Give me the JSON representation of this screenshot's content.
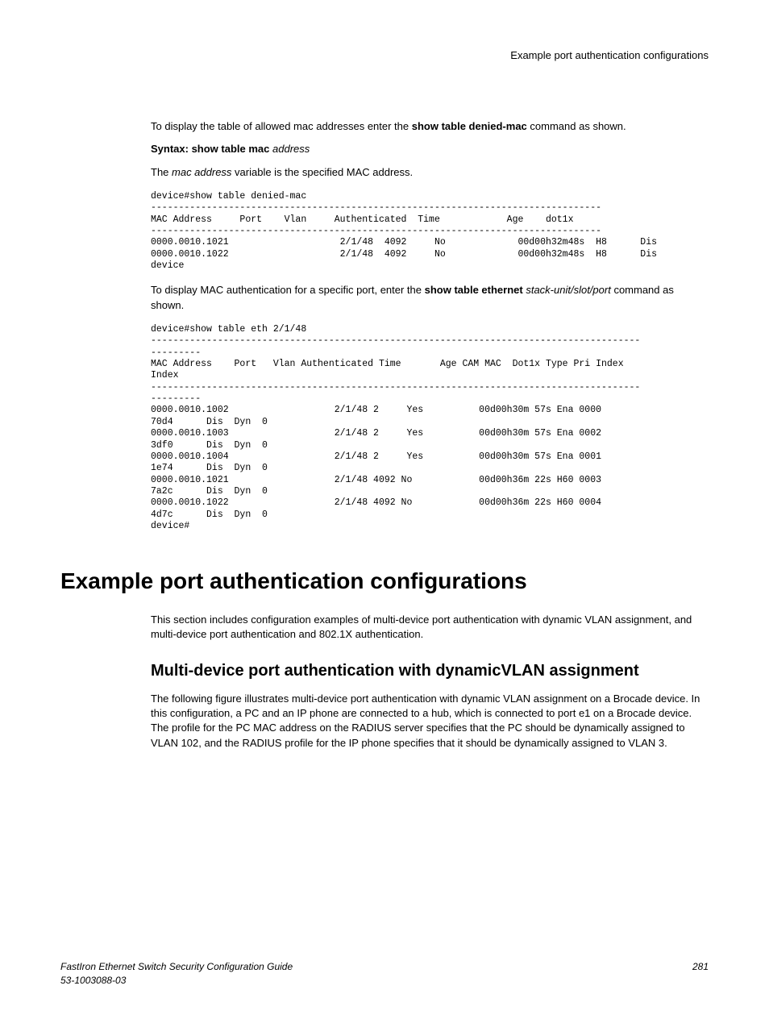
{
  "header": {
    "title": "Example port authentication configurations"
  },
  "intro": {
    "p1a": "To display the table of allowed mac addresses enter the ",
    "p1b": "show table denied-mac",
    "p1c": " command as shown.",
    "syntax_label": "Syntax: show table mac ",
    "syntax_arg": "address",
    "p2a": "The ",
    "p2b": "mac address",
    "p2c": " variable is the specified MAC address."
  },
  "code1": "device#show table denied-mac\n---------------------------------------------------------------------------------\nMAC Address     Port    Vlan     Authenticated  Time            Age    dot1x\n---------------------------------------------------------------------------------\n0000.0010.1021                    2/1/48  4092     No             00d00h32m48s  H8      Dis\n0000.0010.1022                    2/1/48  4092     No             00d00h32m48s  H8      Dis\ndevice",
  "mid": {
    "p1a": "To display MAC authentication for a specific port, enter the ",
    "p1b": "show table ethernet ",
    "p1c": "stack-unit/slot/port",
    "p1d": " command as shown."
  },
  "code2": "device#show table eth 2/1/48\n----------------------------------------------------------------------------------------\n---------\nMAC Address    Port   Vlan Authenticated Time       Age CAM MAC  Dot1x Type Pri Index\nIndex\n----------------------------------------------------------------------------------------\n---------\n0000.0010.1002                   2/1/48 2     Yes          00d00h30m 57s Ena 0000\n70d4      Dis  Dyn  0\n0000.0010.1003                   2/1/48 2     Yes          00d00h30m 57s Ena 0002\n3df0      Dis  Dyn  0\n0000.0010.1004                   2/1/48 2     Yes          00d00h30m 57s Ena 0001\n1e74      Dis  Dyn  0\n0000.0010.1021                   2/1/48 4092 No            00d00h36m 22s H60 0003\n7a2c      Dis  Dyn  0\n0000.0010.1022                   2/1/48 4092 No            00d00h36m 22s H60 0004\n4d7c      Dis  Dyn  0\ndevice#",
  "sections": {
    "h1": "Example port authentication configurations",
    "p1": "This section includes configuration examples of multi-device port authentication with dynamic VLAN assignment, and multi-device port authentication and 802.1X authentication.",
    "h2": "Multi-device port authentication with dynamicVLAN assignment",
    "p2": "The following figure illustrates multi-device port authentication with dynamic VLAN assignment on a Brocade device. In this configuration, a PC and an IP phone are connected to a hub, which is connected to port e1 on a Brocade device. The profile for the PC MAC address on the RADIUS server specifies that the PC should be dynamically assigned to VLAN 102, and the RADIUS profile for the IP phone specifies that it should be dynamically assigned to VLAN 3."
  },
  "footer": {
    "left1": "FastIron Ethernet Switch Security Configuration Guide",
    "left2": "53-1003088-03",
    "right": "281"
  }
}
